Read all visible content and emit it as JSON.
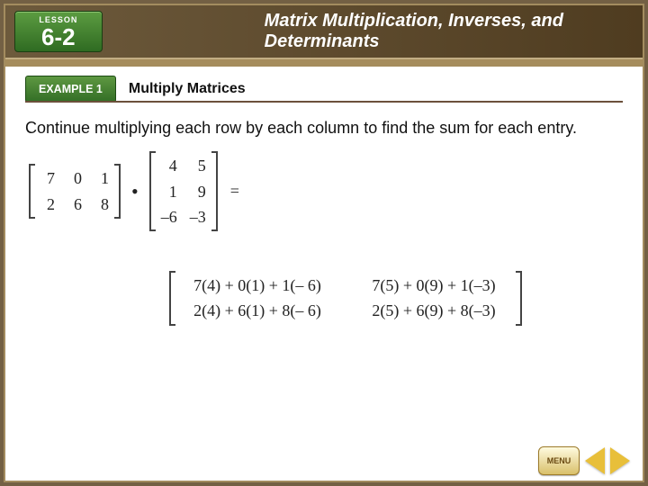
{
  "lesson": {
    "label": "LESSON",
    "number": "6-2"
  },
  "chapter_title": "Matrix Multiplication, Inverses, and Determinants",
  "example_label": "EXAMPLE 1",
  "example_title": "Multiply Matrices",
  "body_text": "Continue multiplying each row by each column to find the sum for each entry.",
  "matrix_A": {
    "rows": 2,
    "cols": 3,
    "cells": [
      [
        "7",
        "0",
        "1"
      ],
      [
        "2",
        "6",
        "8"
      ]
    ]
  },
  "operator_dot": "•",
  "matrix_B": {
    "rows": 3,
    "cols": 2,
    "cells": [
      [
        "4",
        "5"
      ],
      [
        "1",
        "9"
      ],
      [
        "–6",
        "–3"
      ]
    ]
  },
  "operator_eq": "=",
  "result_matrix": {
    "rows": 2,
    "cols": 2,
    "cells": [
      [
        "7(4) + 0(1) + 1(– 6)",
        "7(5) + 0(9) + 1(–3)"
      ],
      [
        "2(4) + 6(1) + 8(– 6)",
        "2(5) + 6(9) + 8(–3)"
      ]
    ]
  },
  "menu_label": "MENU"
}
